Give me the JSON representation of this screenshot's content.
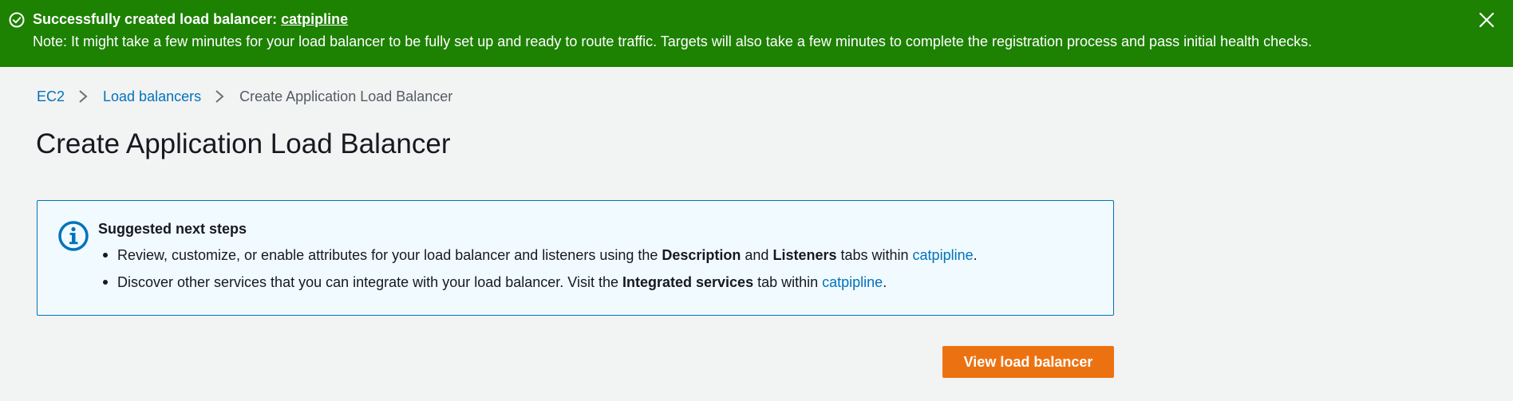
{
  "flash": {
    "status": "success",
    "color": "#1d8102",
    "icon": "check-circle-icon",
    "title_prefix": "Successfully created load balancer: ",
    "title_link": "catpipline",
    "note": "Note: It might take a few minutes for your load balancer to be fully set up and ready to route traffic. Targets will also take a few minutes to complete the registration process and pass initial health checks.",
    "dismiss_icon": "close-icon"
  },
  "breadcrumbs": [
    {
      "label": "EC2",
      "link": true
    },
    {
      "label": "Load balancers",
      "link": true
    },
    {
      "label": "Create Application Load Balancer",
      "link": false
    }
  ],
  "page_title": "Create Application Load Balancer",
  "info_box": {
    "icon": "info-icon",
    "heading": "Suggested next steps",
    "step1": {
      "text_a": "Review, customize, or enable attributes for your load balancer and listeners using the ",
      "bold_a": "Description",
      "text_b": " and ",
      "bold_b": "Listeners",
      "text_c": " tabs within ",
      "link": "catpipline",
      "text_d": "."
    },
    "step2": {
      "text_a": "Discover other services that you can integrate with your load balancer. Visit the ",
      "bold_a": "Integrated services",
      "text_b": " tab within ",
      "link": "catpipline",
      "text_c": "."
    }
  },
  "primary_button": {
    "label": "View load balancer",
    "color": "#ec7211"
  },
  "colors": {
    "link": "#0073bb",
    "background": "#f2f3f3",
    "info_background": "#f1faff",
    "info_border": "#0073bb"
  }
}
